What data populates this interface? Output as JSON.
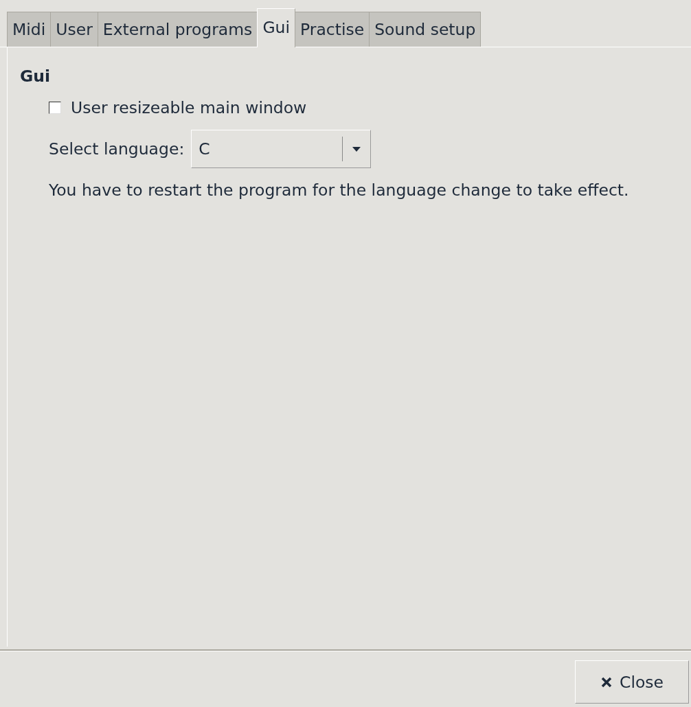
{
  "tabs": [
    {
      "label": "Midi",
      "selected": false
    },
    {
      "label": "User",
      "selected": false
    },
    {
      "label": "External programs",
      "selected": false
    },
    {
      "label": "Gui",
      "selected": true
    },
    {
      "label": "Practise",
      "selected": false
    },
    {
      "label": "Sound setup",
      "selected": false
    }
  ],
  "section_title": "Gui",
  "resizeable_checkbox": {
    "label": "User resizeable main window",
    "checked": false
  },
  "language": {
    "label": "Select language:",
    "value": "C"
  },
  "note": "You have to restart the program for the language change to take effect.",
  "close_button": "Close"
}
